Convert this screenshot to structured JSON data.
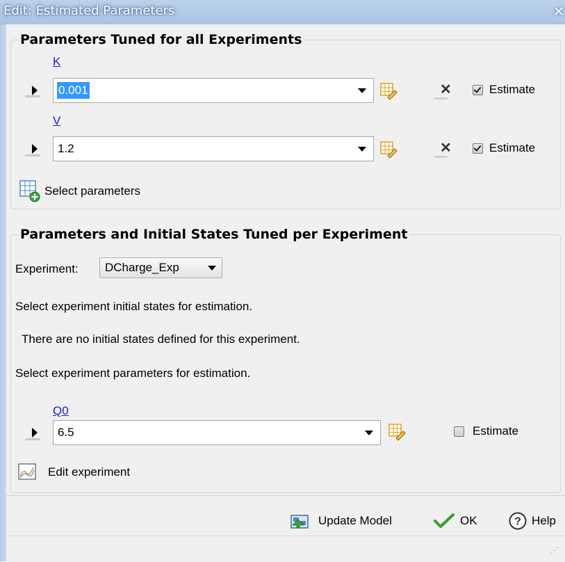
{
  "window": {
    "title": "Edit: Estimated Parameters",
    "close_glyph": "✕"
  },
  "group_all": {
    "title": "Parameters Tuned for all Experiments",
    "params": [
      {
        "name": "K",
        "value": "0.001",
        "estimate_label": "Estimate",
        "estimate_checked": true,
        "selected": true
      },
      {
        "name": "V",
        "value": "1.2",
        "estimate_label": "Estimate",
        "estimate_checked": true,
        "selected": false
      }
    ],
    "select_parameters_label": "Select parameters"
  },
  "group_per_exp": {
    "title": "Parameters and Initial States Tuned per Experiment",
    "experiment_label": "Experiment:",
    "experiment_value": "DCharge_Exp",
    "initial_states_prompt": "Select experiment initial states for estimation.",
    "no_initial_states": "There are no initial states defined for this experiment.",
    "parameters_prompt": "Select experiment parameters for estimation.",
    "params": [
      {
        "name": "Q0",
        "value": "6.5",
        "estimate_label": "Estimate",
        "estimate_checked": false
      }
    ],
    "edit_experiment_label": "Edit experiment"
  },
  "footer": {
    "update_model_label": "Update Model",
    "ok_label": "OK",
    "help_label": "Help"
  },
  "icons": {
    "expand": "expand-arrow-icon",
    "edit_table": "edit-table-icon",
    "delete": "delete-x-icon",
    "select_params": "add-table-icon",
    "edit_experiment": "edit-experiment-icon",
    "update_model": "update-model-icon",
    "ok": "checkmark-icon",
    "help": "help-icon"
  }
}
